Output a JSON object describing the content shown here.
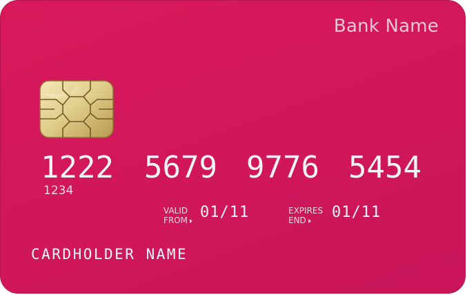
{
  "card": {
    "bank_name": "Bank Name",
    "number_groups": [
      "1222",
      "5679",
      "9776",
      "5454"
    ],
    "small_number": "1234",
    "valid_from": {
      "label_line1": "VALID",
      "label_line2": "FROM",
      "date": "01/11"
    },
    "expires_end": {
      "label_line1": "EXPIRES",
      "label_line2": "END",
      "date": "01/11"
    },
    "cardholder_name": "CARDHOLDER NAME",
    "colors": {
      "card_background": "#d2175b",
      "chip_gold": "#e2cf8e",
      "text_light": "#f4f4f6",
      "bank_name_text": "#e8c8d4"
    },
    "icons": {
      "chip": "emv-chip-icon",
      "arrow": "triangle-right-icon"
    }
  }
}
